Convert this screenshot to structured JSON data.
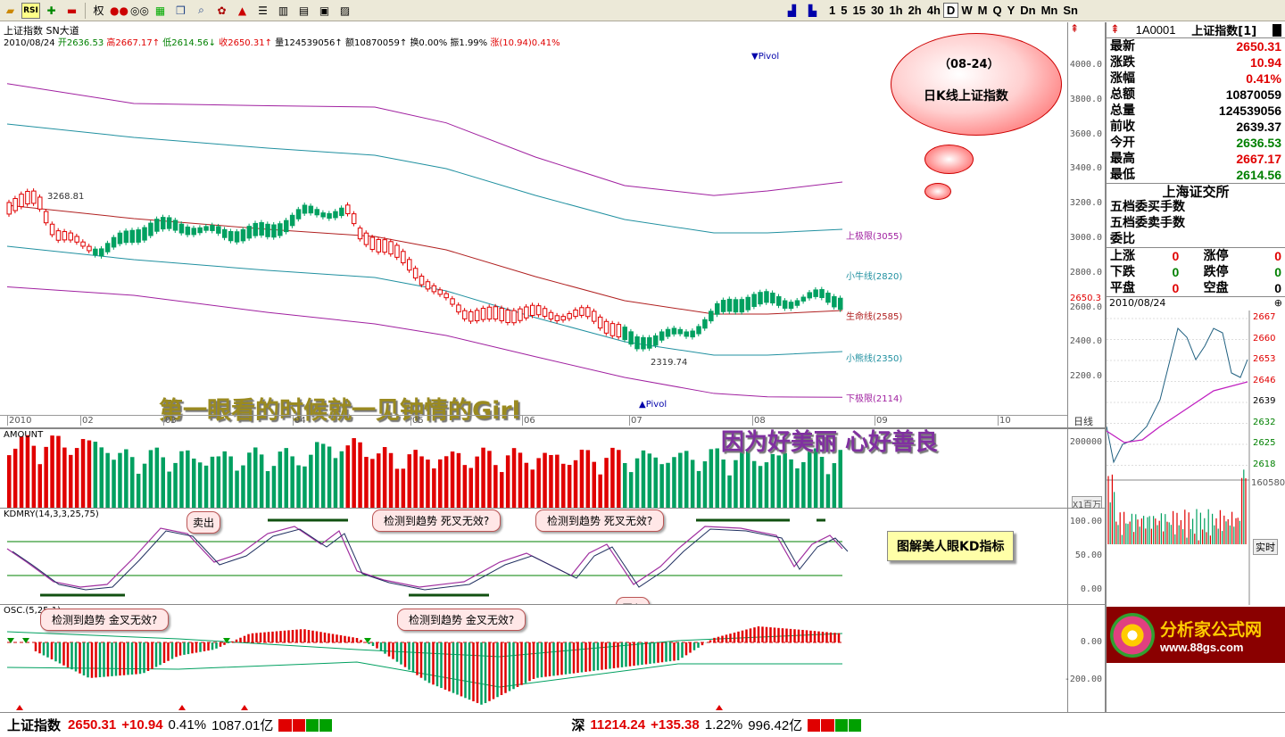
{
  "toolbar": {
    "icons": [
      "folder-icon",
      "rsi-icon",
      "crosshair-icon",
      "minus-icon",
      "quan-label",
      "balance-icon",
      "glasses-icon",
      "grid-icon",
      "book-icon",
      "search-icon",
      "gear-icon",
      "alert-icon",
      "list-icon",
      "columns-icon",
      "window-icon",
      "chart-icon",
      "image-icon"
    ],
    "rsi_label": "RSI",
    "quan_label": "权",
    "periods": [
      "1",
      "5",
      "15",
      "30",
      "1h",
      "2h",
      "4h",
      "D",
      "W",
      "M",
      "Q",
      "Y",
      "Dn",
      "Mn",
      "Sn"
    ],
    "selected_period": "D"
  },
  "main": {
    "title": "上证指数  SN大道",
    "info": {
      "date": "2010/08/24",
      "open": "开2636.53",
      "high": "高2667.17↑",
      "low": "低2614.56↓",
      "close": "收2650.31↑",
      "volume": "量124539056↑",
      "amount": "额10870059↑",
      "turnover": "换0.00%",
      "amplitude": "振1.99%",
      "change": "涨(10.94)0.41%"
    },
    "pivot_top": "▼Pivol",
    "pivot_bottom": "▲Pivol",
    "high_mark": "3268.81",
    "low_mark": "2319.74",
    "last_price_tag": "2650.3",
    "lines": [
      {
        "label": "上极限(3055)",
        "color": "#a020a0"
      },
      {
        "label": "小牛线(2820)",
        "color": "#2090a0"
      },
      {
        "label": "生命线(2585)",
        "color": "#b02020"
      },
      {
        "label": "小熊线(2350)",
        "color": "#2090a0"
      },
      {
        "label": "下极限(2114)",
        "color": "#a020a0"
      }
    ],
    "y_ticks": [
      "4000.0",
      "3800.0",
      "3600.0",
      "3400.0",
      "3200.0",
      "3000.0",
      "2800.0",
      "2600.0",
      "2400.0",
      "2200.0"
    ],
    "months": [
      "2010",
      "02",
      "03",
      "04",
      "05",
      "06",
      "07",
      "08",
      "09",
      "10"
    ],
    "daily_label": "日线",
    "cloud_date": "（08-24）",
    "cloud_title": "日K线上证指数",
    "caption1": "第一眼看的时候就一见钟情的Girl",
    "caption2": "因为好美丽  心好善良"
  },
  "amount_pane": {
    "title": "AMOUNT",
    "tick": "200000",
    "unit": "X1百万"
  },
  "kd_pane": {
    "title": "KDMRY(14,3,3,25,75)",
    "ticks": [
      "100.00",
      "50.00",
      "0.00"
    ],
    "bubbles": [
      "卖出",
      "检测到趋势 死叉无效?",
      "检测到趋势 死叉无效?",
      "检测到趋势 金叉无效?",
      "检测到趋势 金叉无效?",
      "买入"
    ],
    "box": "图解美人眼KD指标"
  },
  "osc_pane": {
    "title": "OSC.(5,25,1)",
    "ticks": [
      "0.00",
      "-200.00"
    ]
  },
  "side": {
    "code": "1A0001",
    "name": "上证指数[1]",
    "quotes": [
      {
        "k": "最新",
        "v": "2650.31",
        "c": "red"
      },
      {
        "k": "涨跌",
        "v": "10.94",
        "c": "red"
      },
      {
        "k": "涨幅",
        "v": "0.41%",
        "c": "red"
      },
      {
        "k": "总额",
        "v": "10870059",
        "c": "blk"
      },
      {
        "k": "总量",
        "v": "124539056",
        "c": "blk"
      },
      {
        "k": "前收",
        "v": "2639.37",
        "c": "blk"
      },
      {
        "k": "今开",
        "v": "2636.53",
        "c": "green"
      },
      {
        "k": "最高",
        "v": "2667.17",
        "c": "red"
      },
      {
        "k": "最低",
        "v": "2614.56",
        "c": "green"
      }
    ],
    "exchange": "上海证交所",
    "rows": [
      "五档委买手数",
      "五档委卖手数",
      "委比"
    ],
    "stats": [
      {
        "a": "上涨",
        "av": "0",
        "b": "涨停",
        "bv": "0"
      },
      {
        "a": "下跌",
        "av": "0",
        "b": "跌停",
        "bv": "0"
      },
      {
        "a": "平盘",
        "av": "0",
        "b": "空盘",
        "bv": "0"
      }
    ],
    "mini_date": "2010/08/24",
    "mini_ticks": [
      "2667",
      "2660",
      "2653",
      "2646",
      "2639",
      "2632",
      "2625",
      "2618"
    ],
    "mini_vol": "160580",
    "realtime": "实时",
    "logo_text": "分析家公式网",
    "logo_url": "www.88gs.com"
  },
  "status": {
    "sh_name": "上证指数",
    "sh_price": "2650.31",
    "sh_change": "+10.94",
    "sh_pct": "0.41%",
    "sh_amt": "1087.01亿",
    "sz_name": "深",
    "sz_price": "11214.24",
    "sz_change": "+135.38",
    "sz_pct": "1.22%",
    "sz_amt": "996.42亿"
  },
  "colors": {
    "up": "#e00000",
    "down": "#00a060",
    "accent": "#a020a0"
  }
}
